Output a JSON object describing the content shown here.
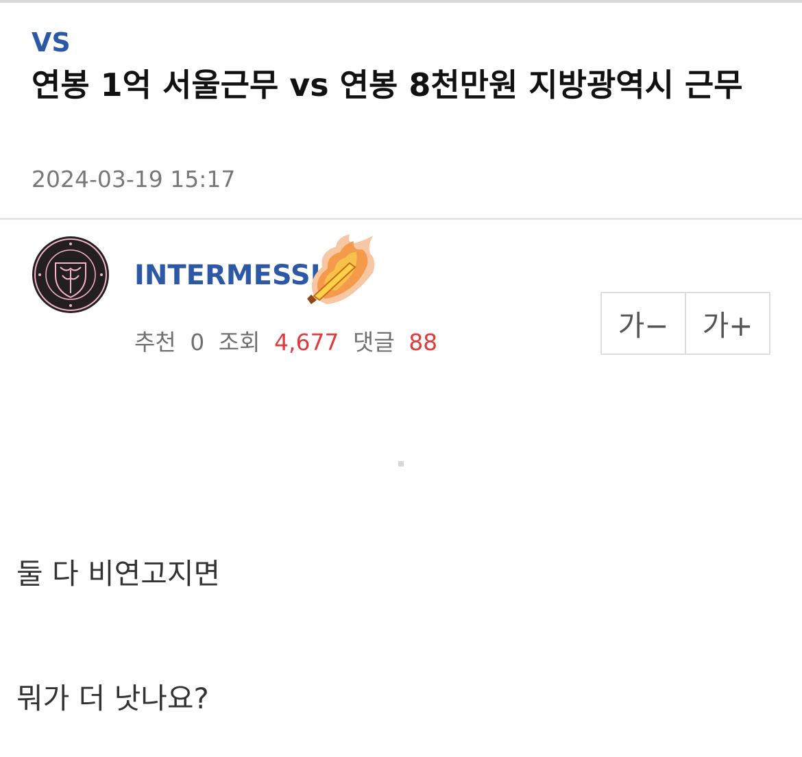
{
  "post": {
    "category": "VS",
    "title": "연봉 1억 서울근무 vs 연봉 8천만원 지방광역시 근무",
    "date": "2024-03-19 15:17"
  },
  "author": {
    "name": "INTERMESSI",
    "avatar_icon": "inter-miami-crest-icon",
    "badge_icon": "flaming-sword-rank-icon"
  },
  "stats": {
    "recommend_label": "추천",
    "recommend_count": "0",
    "views_label": "조회",
    "views_count": "4,677",
    "comments_label": "댓글",
    "comments_count": "88"
  },
  "font_controls": {
    "decrease_label": "가−",
    "increase_label": "가+"
  },
  "content": {
    "lines": [
      "둘 다 비연고지면",
      "뭐가 더 낫나요?"
    ]
  },
  "colors": {
    "category": "#2c58a6",
    "author": "#2c58a6",
    "highlight_number": "#e03b3b",
    "muted": "#777777"
  }
}
